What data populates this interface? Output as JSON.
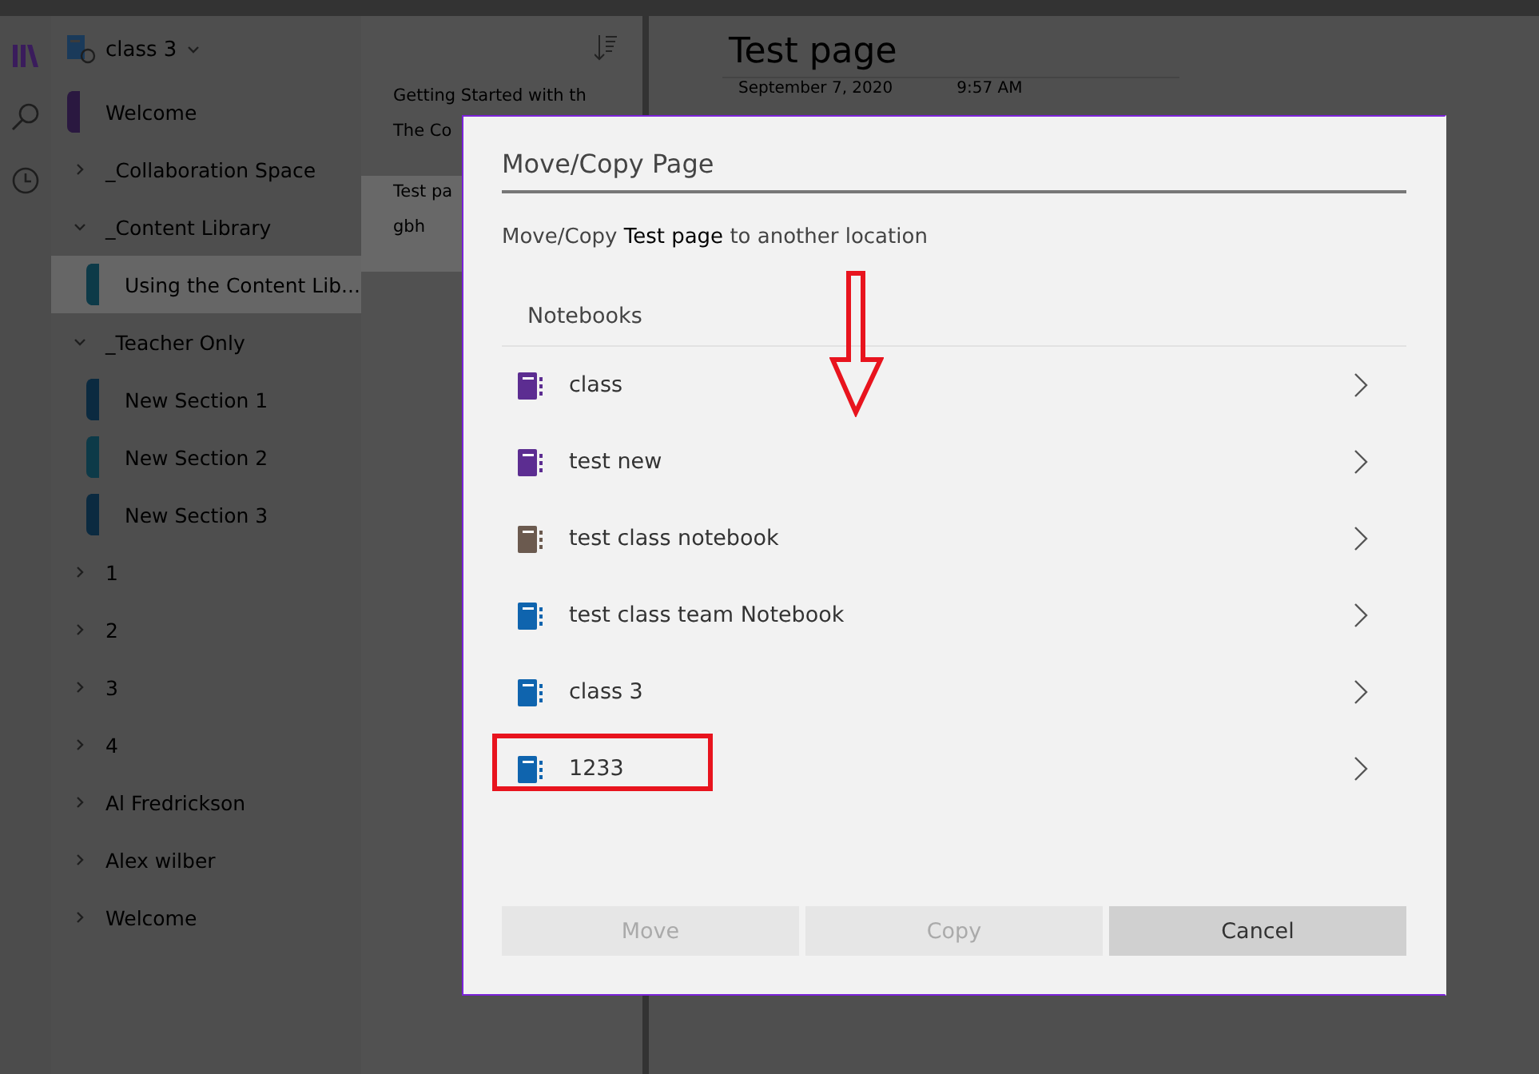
{
  "notebook_picker": {
    "name": "class 3"
  },
  "sections": [
    {
      "kind": "section",
      "label": "Welcome",
      "color": "#2a1840",
      "selected": false
    },
    {
      "kind": "group",
      "label": "_Collaboration Space",
      "expanded": false
    },
    {
      "kind": "group",
      "label": "_Content Library",
      "expanded": true,
      "children": [
        {
          "kind": "section",
          "label": "Using the Content Lib...",
          "color": "#0d3a48",
          "selected": true
        }
      ]
    },
    {
      "kind": "group",
      "label": "_Teacher Only",
      "expanded": true,
      "children": [
        {
          "kind": "section",
          "label": "New Section 1",
          "color": "#0b2a40",
          "selected": false
        },
        {
          "kind": "section",
          "label": "New Section 2",
          "color": "#0d3a48",
          "selected": false
        },
        {
          "kind": "section",
          "label": "New Section 3",
          "color": "#0b2a40",
          "selected": false
        }
      ]
    },
    {
      "kind": "group",
      "label": "1",
      "expanded": false
    },
    {
      "kind": "group",
      "label": "2",
      "expanded": false
    },
    {
      "kind": "group",
      "label": "3",
      "expanded": false
    },
    {
      "kind": "group",
      "label": "4",
      "expanded": false
    },
    {
      "kind": "group",
      "label": "Al Fredrickson",
      "expanded": false
    },
    {
      "kind": "group",
      "label": "Alex wilber",
      "expanded": false
    },
    {
      "kind": "group",
      "label": "Welcome",
      "expanded": false
    }
  ],
  "pages": [
    {
      "title": "Getting Started with th",
      "preview": "The Co",
      "selected": false
    },
    {
      "title": "Test pa",
      "preview": "gbh",
      "selected": true
    }
  ],
  "page": {
    "title": "Test page",
    "date": "September 7, 2020",
    "time": "9:57 AM"
  },
  "dialog": {
    "title": "Move/Copy Page",
    "message": "Move/Copy **Test page**  to another location",
    "list_header": "Notebooks",
    "notebooks": [
      {
        "name": "class",
        "color": "#5c2d91",
        "highlighted": false
      },
      {
        "name": "test new",
        "color": "#5c2d91",
        "highlighted": false
      },
      {
        "name": "test class notebook",
        "color": "#6b5a4f",
        "highlighted": false
      },
      {
        "name": "test class team Notebook",
        "color": "#0f64ae",
        "highlighted": false
      },
      {
        "name": "class 3",
        "color": "#0f64ae",
        "highlighted": false
      },
      {
        "name": "1233",
        "color": "#0f64ae",
        "highlighted": true
      }
    ],
    "buttons": [
      {
        "label": "Move",
        "disabled": true
      },
      {
        "label": "Copy",
        "disabled": true
      },
      {
        "label": "Cancel",
        "disabled": false
      }
    ]
  }
}
